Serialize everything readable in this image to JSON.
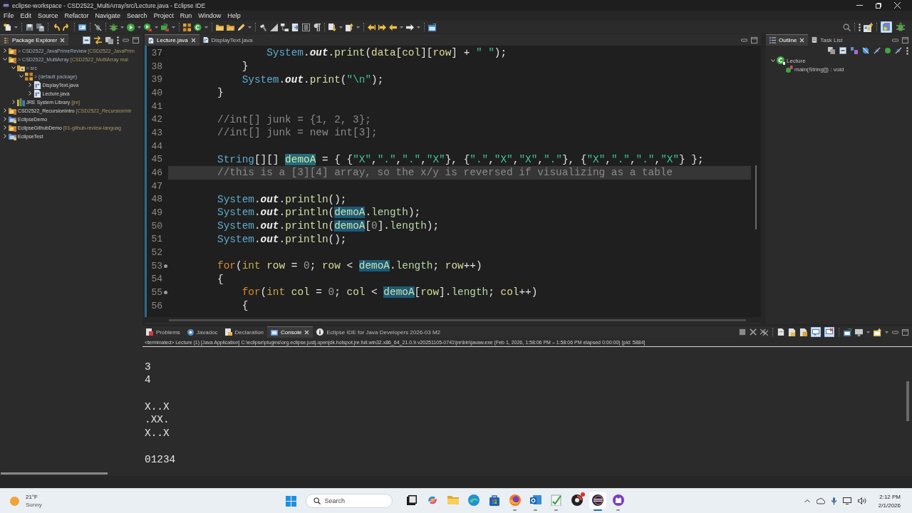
{
  "window": {
    "title": "eclipse-workspace - CSD2522_MultiArray/src/Lecture.java - Eclipse IDE"
  },
  "menu": [
    "File",
    "Edit",
    "Source",
    "Refactor",
    "Navigate",
    "Search",
    "Project",
    "Run",
    "Window",
    "Help"
  ],
  "perspectives": [
    {
      "kind": "java",
      "selected": true
    },
    {
      "kind": "debug",
      "selected": false
    }
  ],
  "package_explorer": {
    "tabs": [
      {
        "label": "Package Explorer",
        "selected": true
      }
    ],
    "tree": [
      {
        "kind": "git_project",
        "marker": ">",
        "label": "CSD2522_JavaPrimeReview",
        "repo": "[CSD2522_JavaPrim",
        "expanded": false
      },
      {
        "kind": "git_project",
        "marker": ">",
        "label": "CSD2522_MultiArray",
        "repo": "[CSD2522_MultiArray mai",
        "expanded": true,
        "children": [
          {
            "kind": "source_folder",
            "marker": ">",
            "label": "src",
            "expanded": true,
            "children": [
              {
                "kind": "package",
                "marker": ">",
                "label": "(default package)",
                "expanded": true,
                "children": [
                  {
                    "kind": "java_file",
                    "label": "DisplayText.java",
                    "expanded": false
                  },
                  {
                    "kind": "java_file",
                    "label": "Lecture.java",
                    "expanded": false
                  }
                ]
              }
            ]
          },
          {
            "kind": "library",
            "label": "JRE System Library",
            "repo": "[jre]",
            "expanded": false
          }
        ]
      },
      {
        "kind": "git_project",
        "label": "CSD2522_RecursionIntro",
        "repo": "[CSD2522_RecursionIntr",
        "expanded": false
      },
      {
        "kind": "project",
        "label": "EclipseDemo",
        "expanded": false
      },
      {
        "kind": "git_project",
        "label": "EclipseGithubDemo",
        "repo": "[01-github-review-languag",
        "expanded": false
      },
      {
        "kind": "project",
        "label": "EclipseTest",
        "expanded": false
      }
    ]
  },
  "editor": {
    "tabs": [
      {
        "label": "Lecture.java",
        "selected": true
      },
      {
        "label": "DisplayText.java",
        "selected": false
      }
    ],
    "lines": [
      {
        "number": "37",
        "foldable": false,
        "current": false,
        "tokens": [
          {
            "text": "                System",
            "kind": "type"
          },
          {
            "text": ".",
            "kind": "plain"
          },
          {
            "text": "out",
            "kind": "static_field"
          },
          {
            "text": ".",
            "kind": "plain"
          },
          {
            "text": "print",
            "kind": "method"
          },
          {
            "text": "(",
            "kind": "plain"
          },
          {
            "text": "data",
            "kind": "variable"
          },
          {
            "text": "[",
            "kind": "plain"
          },
          {
            "text": "col",
            "kind": "variable"
          },
          {
            "text": "][",
            "kind": "plain"
          },
          {
            "text": "row",
            "kind": "variable"
          },
          {
            "text": "] + ",
            "kind": "plain"
          },
          {
            "text": "\" \"",
            "kind": "string"
          },
          {
            "text": ");",
            "kind": "plain"
          }
        ]
      },
      {
        "number": "38",
        "foldable": false,
        "current": false,
        "tokens": [
          {
            "text": "            }",
            "kind": "plain"
          }
        ]
      },
      {
        "number": "39",
        "foldable": false,
        "current": false,
        "tokens": [
          {
            "text": "            System",
            "kind": "type"
          },
          {
            "text": ".",
            "kind": "plain"
          },
          {
            "text": "out",
            "kind": "static_field"
          },
          {
            "text": ".",
            "kind": "plain"
          },
          {
            "text": "print",
            "kind": "method"
          },
          {
            "text": "(",
            "kind": "plain"
          },
          {
            "text": "\"\\n\"",
            "kind": "string"
          },
          {
            "text": ");",
            "kind": "plain"
          }
        ]
      },
      {
        "number": "40",
        "foldable": false,
        "current": false,
        "tokens": [
          {
            "text": "        }",
            "kind": "plain"
          }
        ]
      },
      {
        "number": "41",
        "foldable": false,
        "current": false
      },
      {
        "number": "42",
        "foldable": false,
        "current": false,
        "tokens": [
          {
            "text": "        //int[] junk = {1, 2, 3};",
            "kind": "comment"
          }
        ]
      },
      {
        "number": "43",
        "foldable": false,
        "current": false,
        "tokens": [
          {
            "text": "        //int[] junk = new int[3];",
            "kind": "comment"
          }
        ]
      },
      {
        "number": "44",
        "foldable": false,
        "current": false
      },
      {
        "number": "45",
        "foldable": false,
        "current": false,
        "tokens": [
          {
            "text": "        String",
            "kind": "type"
          },
          {
            "text": "[][] ",
            "kind": "plain"
          },
          {
            "text": "demoA",
            "kind": "write_occurrence"
          },
          {
            "text": " = { {",
            "kind": "plain"
          },
          {
            "text": "\"X\"",
            "kind": "string"
          },
          {
            "text": ",",
            "kind": "plain"
          },
          {
            "text": "\".\"",
            "kind": "string"
          },
          {
            "text": ",",
            "kind": "plain"
          },
          {
            "text": "\".\"",
            "kind": "string"
          },
          {
            "text": ",",
            "kind": "plain"
          },
          {
            "text": "\"X\"",
            "kind": "string"
          },
          {
            "text": "}, {",
            "kind": "plain"
          },
          {
            "text": "\".\"",
            "kind": "string"
          },
          {
            "text": ",",
            "kind": "plain"
          },
          {
            "text": "\"X\"",
            "kind": "string"
          },
          {
            "text": ",",
            "kind": "plain"
          },
          {
            "text": "\"X\"",
            "kind": "string"
          },
          {
            "text": ",",
            "kind": "plain"
          },
          {
            "text": "\".\"",
            "kind": "string"
          },
          {
            "text": "}, {",
            "kind": "plain"
          },
          {
            "text": "\"X\"",
            "kind": "string"
          },
          {
            "text": ",",
            "kind": "plain"
          },
          {
            "text": "\".\"",
            "kind": "string"
          },
          {
            "text": ",",
            "kind": "plain"
          },
          {
            "text": "\".\"",
            "kind": "string"
          },
          {
            "text": ",",
            "kind": "plain"
          },
          {
            "text": "\"X\"",
            "kind": "string"
          },
          {
            "text": "} };",
            "kind": "plain"
          }
        ]
      },
      {
        "number": "46",
        "foldable": false,
        "current": true,
        "tokens": [
          {
            "text": "        //this is a [3][4] array, so the x/y is reversed if visualizing as a table",
            "kind": "comment"
          }
        ]
      },
      {
        "number": "47",
        "foldable": false,
        "current": false
      },
      {
        "number": "48",
        "foldable": false,
        "current": false,
        "tokens": [
          {
            "text": "        System",
            "kind": "type"
          },
          {
            "text": ".",
            "kind": "plain"
          },
          {
            "text": "out",
            "kind": "static_field"
          },
          {
            "text": ".",
            "kind": "plain"
          },
          {
            "text": "println",
            "kind": "method"
          },
          {
            "text": "();",
            "kind": "plain"
          }
        ]
      },
      {
        "number": "49",
        "foldable": false,
        "current": false,
        "tokens": [
          {
            "text": "        System",
            "kind": "type"
          },
          {
            "text": ".",
            "kind": "plain"
          },
          {
            "text": "out",
            "kind": "static_field"
          },
          {
            "text": ".",
            "kind": "plain"
          },
          {
            "text": "println",
            "kind": "method"
          },
          {
            "text": "(",
            "kind": "plain"
          },
          {
            "text": "demoA",
            "kind": "occurrence"
          },
          {
            "text": ".",
            "kind": "plain"
          },
          {
            "text": "length",
            "kind": "field"
          },
          {
            "text": ");",
            "kind": "plain"
          }
        ]
      },
      {
        "number": "50",
        "foldable": false,
        "current": false,
        "tokens": [
          {
            "text": "        System",
            "kind": "type"
          },
          {
            "text": ".",
            "kind": "plain"
          },
          {
            "text": "out",
            "kind": "static_field"
          },
          {
            "text": ".",
            "kind": "plain"
          },
          {
            "text": "println",
            "kind": "method"
          },
          {
            "text": "(",
            "kind": "plain"
          },
          {
            "text": "demoA",
            "kind": "occurrence"
          },
          {
            "text": "[",
            "kind": "plain"
          },
          {
            "text": "0",
            "kind": "number"
          },
          {
            "text": "].",
            "kind": "plain"
          },
          {
            "text": "length",
            "kind": "field"
          },
          {
            "text": ");",
            "kind": "plain"
          }
        ]
      },
      {
        "number": "51",
        "foldable": false,
        "current": false,
        "tokens": [
          {
            "text": "        System",
            "kind": "type"
          },
          {
            "text": ".",
            "kind": "plain"
          },
          {
            "text": "out",
            "kind": "static_field"
          },
          {
            "text": ".",
            "kind": "plain"
          },
          {
            "text": "println",
            "kind": "method"
          },
          {
            "text": "();",
            "kind": "plain"
          }
        ]
      },
      {
        "number": "52",
        "foldable": false,
        "current": false
      },
      {
        "number": "53",
        "foldable": true,
        "current": false,
        "tokens": [
          {
            "text": "        for",
            "kind": "keyword"
          },
          {
            "text": "(",
            "kind": "plain"
          },
          {
            "text": "int",
            "kind": "primitive"
          },
          {
            "text": " row",
            "kind": "variable"
          },
          {
            "text": " = ",
            "kind": "plain"
          },
          {
            "text": "0",
            "kind": "number"
          },
          {
            "text": "; ",
            "kind": "plain"
          },
          {
            "text": "row",
            "kind": "variable"
          },
          {
            "text": " < ",
            "kind": "plain"
          },
          {
            "text": "demoA",
            "kind": "occurrence"
          },
          {
            "text": ".",
            "kind": "plain"
          },
          {
            "text": "length",
            "kind": "field"
          },
          {
            "text": "; ",
            "kind": "plain"
          },
          {
            "text": "row",
            "kind": "variable"
          },
          {
            "text": "++)",
            "kind": "plain"
          }
        ]
      },
      {
        "number": "54",
        "foldable": false,
        "current": false,
        "tokens": [
          {
            "text": "        {",
            "kind": "plain"
          }
        ]
      },
      {
        "number": "55",
        "foldable": true,
        "current": false,
        "tokens": [
          {
            "text": "            for",
            "kind": "keyword"
          },
          {
            "text": "(",
            "kind": "plain"
          },
          {
            "text": "int",
            "kind": "primitive"
          },
          {
            "text": " col",
            "kind": "variable"
          },
          {
            "text": " = ",
            "kind": "plain"
          },
          {
            "text": "0",
            "kind": "number"
          },
          {
            "text": "; ",
            "kind": "plain"
          },
          {
            "text": "col",
            "kind": "variable"
          },
          {
            "text": " < ",
            "kind": "plain"
          },
          {
            "text": "demoA",
            "kind": "occurrence"
          },
          {
            "text": "[",
            "kind": "plain"
          },
          {
            "text": "row",
            "kind": "variable"
          },
          {
            "text": "].",
            "kind": "plain"
          },
          {
            "text": "length",
            "kind": "field"
          },
          {
            "text": "; ",
            "kind": "plain"
          },
          {
            "text": "col",
            "kind": "variable"
          },
          {
            "text": "++)",
            "kind": "plain"
          }
        ]
      },
      {
        "number": "56",
        "foldable": false,
        "current": false,
        "tokens": [
          {
            "text": "            {",
            "kind": "plain"
          }
        ]
      }
    ]
  },
  "outline": {
    "tabs": [
      {
        "kind": "outline",
        "label": "Outline",
        "selected": true
      },
      {
        "kind": "tasks",
        "label": "Task List",
        "selected": false
      }
    ],
    "tree": [
      {
        "kind": "class",
        "label": "Lecture",
        "expanded": true,
        "children": [
          {
            "kind": "method",
            "label": "main(String[]) : void"
          }
        ]
      }
    ]
  },
  "bottom_panel": {
    "tabs": [
      {
        "kind": "problems",
        "label": "Problems",
        "selected": false
      },
      {
        "kind": "javadoc",
        "label": "Javadoc",
        "selected": false
      },
      {
        "kind": "declaration",
        "label": "Declaration",
        "selected": false
      },
      {
        "kind": "console",
        "label": "Console",
        "selected": true
      },
      {
        "kind": "info",
        "label": "Eclipse IDE for Java Developers 2026-03 M2",
        "selected": false
      }
    ],
    "toggles": [
      {
        "kind": "stdout",
        "on": true
      },
      {
        "kind": "stderr",
        "on": true
      }
    ],
    "console": {
      "status": "<terminated> Lecture (1) [Java Application] C:\\eclipse\\plugins\\org.eclipse.justj.openjdk.hotspot.jre.full.win32.x86_64_21.0.9.v20251105-0741\\jre\\bin\\javaw.exe (Feb 1, 2026, 1:58:06 PM – 1:58:06 PM elapsed 0:00:00) [pid: 5884]",
      "blocks": [
        [
          "3",
          "4"
        ],
        [
          "X..X",
          ".XX.",
          "X..X"
        ],
        [
          "01234"
        ]
      ]
    }
  },
  "taskbar": {
    "weather": {
      "temperature": "21°F",
      "condition": "Sunny"
    },
    "search": {
      "placeholder": "Search"
    },
    "apps": [
      {
        "kind": "task_view",
        "running": false,
        "active": false,
        "notification": false
      },
      {
        "kind": "assistant",
        "running": false,
        "active": false,
        "notification": false
      },
      {
        "kind": "files",
        "running": false,
        "active": false,
        "notification": false
      },
      {
        "kind": "browser_wave",
        "running": false,
        "active": false,
        "notification": false
      },
      {
        "kind": "store",
        "running": false,
        "active": false,
        "notification": false
      },
      {
        "kind": "browser_fox",
        "running": true,
        "active": false,
        "notification": false
      },
      {
        "kind": "mail",
        "running": true,
        "active": false,
        "notification": false
      },
      {
        "kind": "notes",
        "running": true,
        "active": false,
        "notification": false
      },
      {
        "kind": "media",
        "running": false,
        "active": false,
        "notification": true
      },
      {
        "kind": "ide",
        "running": true,
        "active": true,
        "notification": false
      },
      {
        "kind": "code_host",
        "running": true,
        "active": false,
        "notification": false
      }
    ],
    "clock": {
      "time": "2:12 PM",
      "date": "2/1/2026"
    }
  }
}
